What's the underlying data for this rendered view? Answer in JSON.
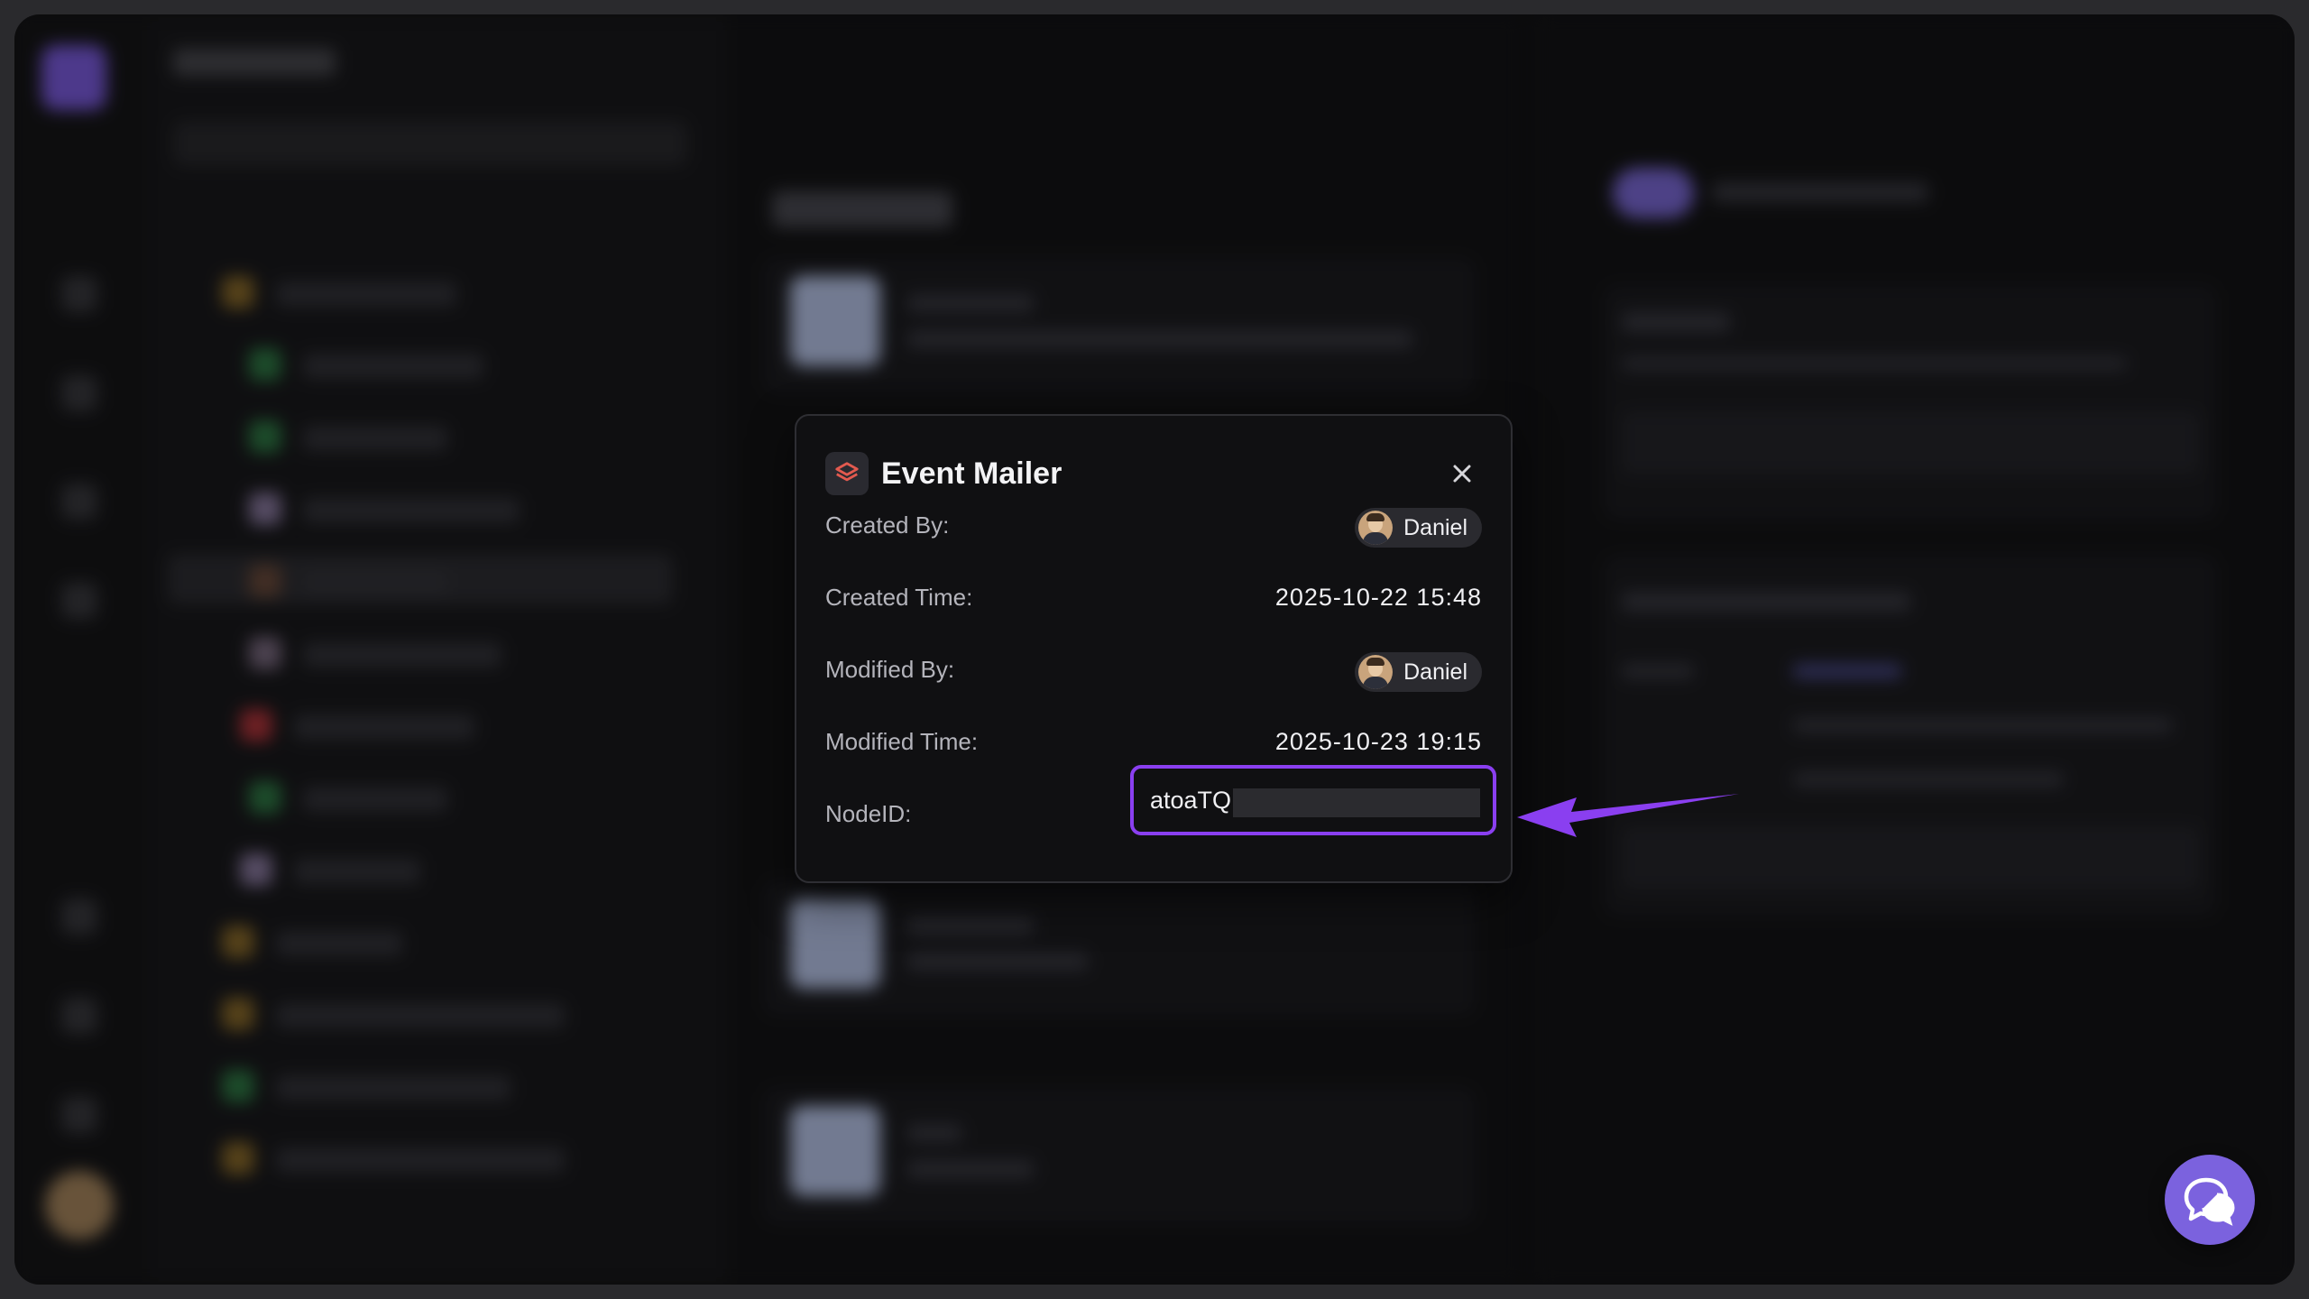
{
  "popup": {
    "title": "Event Mailer",
    "icon": "stack-layers-icon",
    "rows": {
      "created_by": {
        "label": "Created By:",
        "value": "Daniel"
      },
      "created_time": {
        "label": "Created Time:",
        "value": "2025-10-22 15:48"
      },
      "modified_by": {
        "label": "Modified By:",
        "value": "Daniel"
      },
      "modified_time": {
        "label": "Modified Time:",
        "value": "2025-10-23 19:15"
      },
      "node_id": {
        "label": "NodeID:",
        "value": "atoaTQ!",
        "redacted": true
      }
    }
  },
  "colors": {
    "accent": "#8a3ff0",
    "icon_red": "#e35a4f",
    "help_button": "#7b62de"
  }
}
